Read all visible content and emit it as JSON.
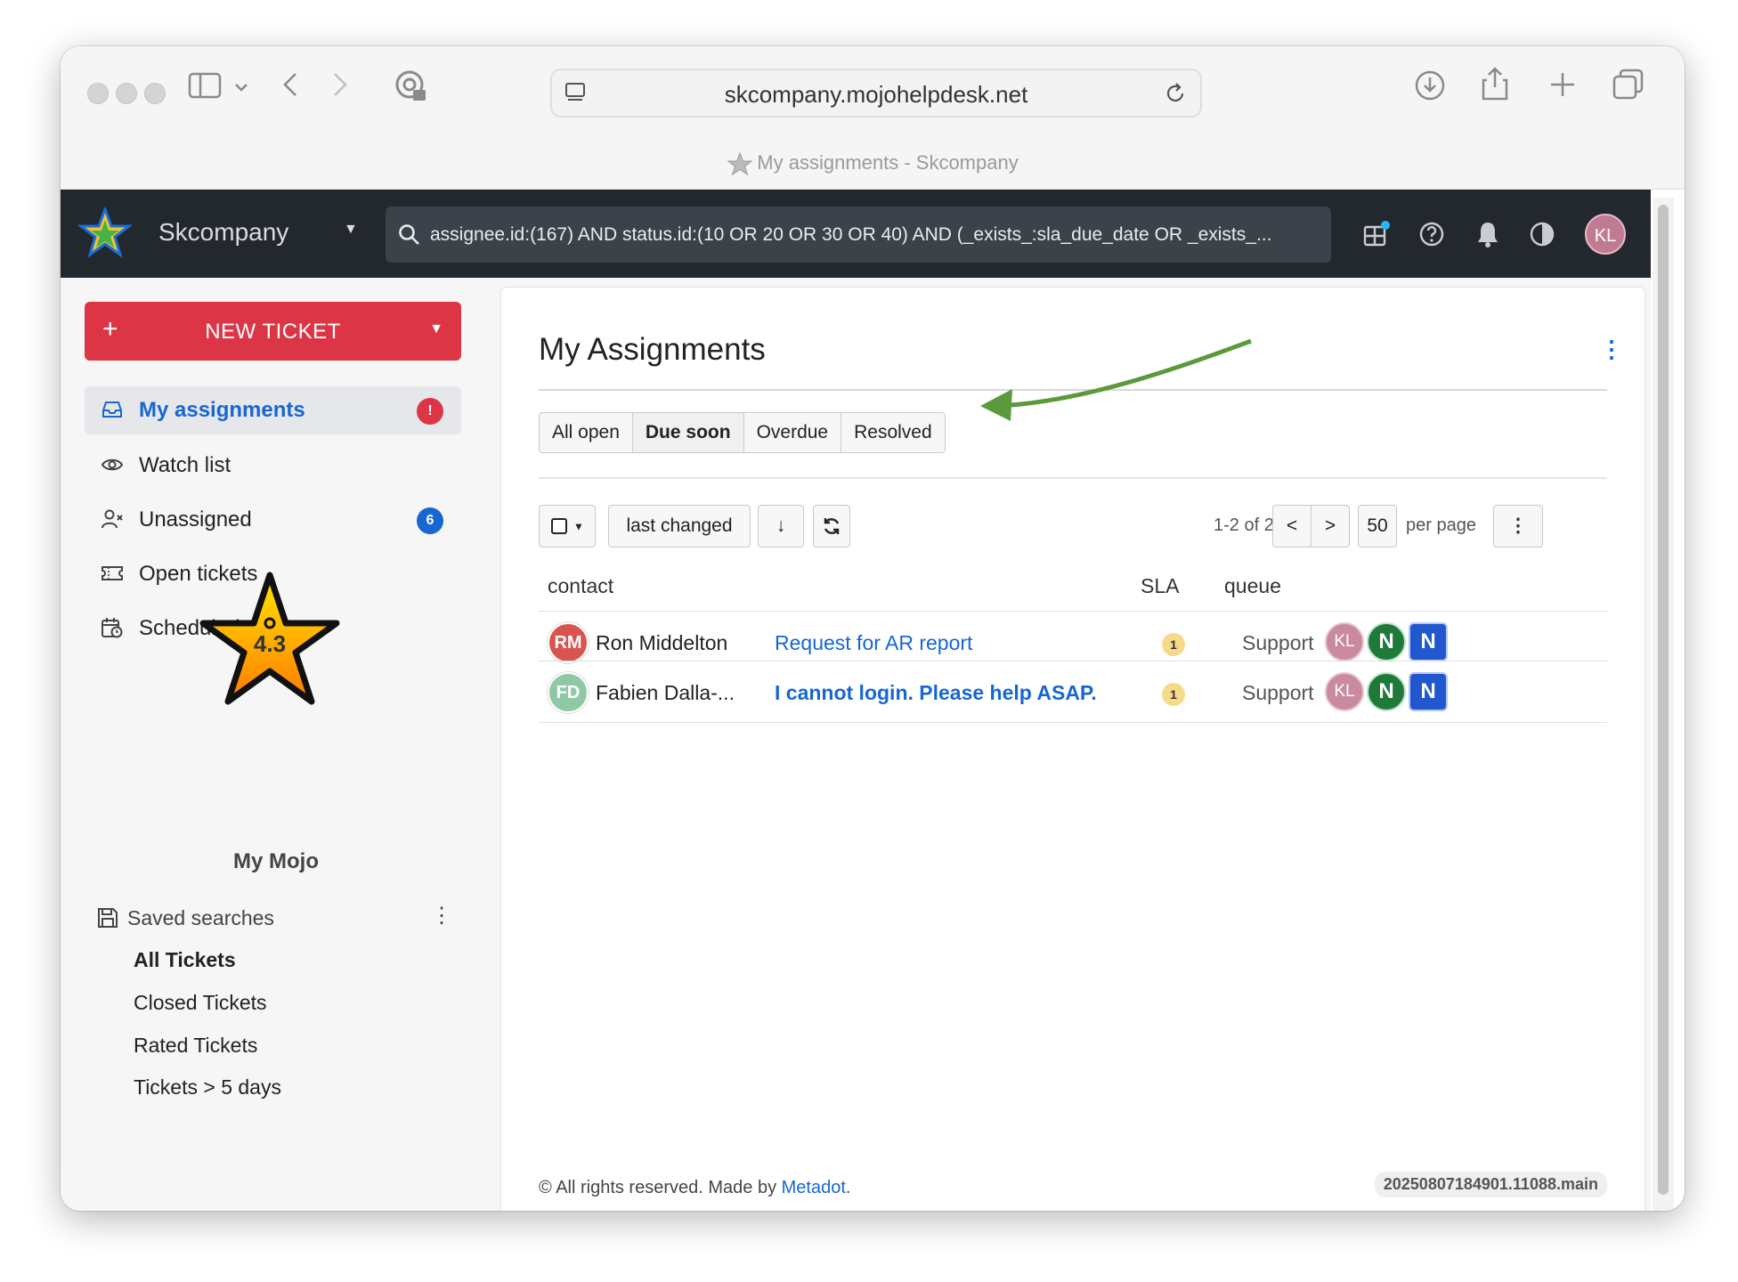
{
  "browser": {
    "url": "skcompany.mojohelpdesk.net",
    "tab_title": "My assignments - Skcompany"
  },
  "header": {
    "brand": "Skcompany",
    "search_query": "assignee.id:(167) AND status.id:(10 OR 20 OR 30 OR 40) AND (_exists_:sla_due_date OR _exists_...",
    "user_initials": "KL"
  },
  "sidebar": {
    "new_ticket_label": "NEW TICKET",
    "items": [
      {
        "label": "My assignments",
        "icon": "inbox-icon",
        "badge": "!"
      },
      {
        "label": "Watch list",
        "icon": "eye-icon",
        "badge": ""
      },
      {
        "label": "Unassigned",
        "icon": "user-x-icon",
        "badge": "6"
      },
      {
        "label": "Open tickets",
        "icon": "ticket-icon",
        "badge": ""
      },
      {
        "label": "Scheduled",
        "icon": "calendar-clock-icon",
        "badge": ""
      }
    ],
    "mojo_score": "4.3",
    "mojo_label": "My Mojo",
    "saved_searches_label": "Saved searches",
    "saved_searches": [
      "All Tickets",
      "Closed Tickets",
      "Rated Tickets",
      "Tickets > 5 days"
    ]
  },
  "main": {
    "title": "My Assignments",
    "tabs": [
      {
        "label": "All open",
        "active": false
      },
      {
        "label": "Due soon",
        "active": true
      },
      {
        "label": "Overdue",
        "active": false
      },
      {
        "label": "Resolved",
        "active": false
      }
    ],
    "sort_label": "last changed",
    "sort_direction": "↓",
    "pager_range": "1-2 of 2",
    "prev": "<",
    "next": ">",
    "per_page_value": "50",
    "per_page_label": "per page",
    "columns": {
      "contact": "contact",
      "sla": "SLA",
      "queue": "queue"
    },
    "rows": [
      {
        "initials": "RM",
        "avatar_color": "#d9534f",
        "contact": "Ron Middelton",
        "subject": "Request for AR report",
        "subject_bold": false,
        "sla": "1",
        "queue": "Support",
        "assignees": [
          "KL",
          "N",
          "N"
        ]
      },
      {
        "initials": "FD",
        "avatar_color": "#8fc9a4",
        "contact": "Fabien Dalla-...",
        "subject": "I cannot login. Please help ASAP.",
        "subject_bold": true,
        "sla": "1",
        "queue": "Support",
        "assignees": [
          "KL",
          "N",
          "N"
        ]
      }
    ],
    "footer_text": "© All rights reserved. Made by ",
    "footer_link": "Metadot",
    "footer_end": ".",
    "version": "20250807184901.11088.main"
  },
  "colors": {
    "accent": "#1767d1",
    "danger": "#dc3545",
    "header_bg": "#23282f",
    "arrow": "#5a9a3a"
  }
}
